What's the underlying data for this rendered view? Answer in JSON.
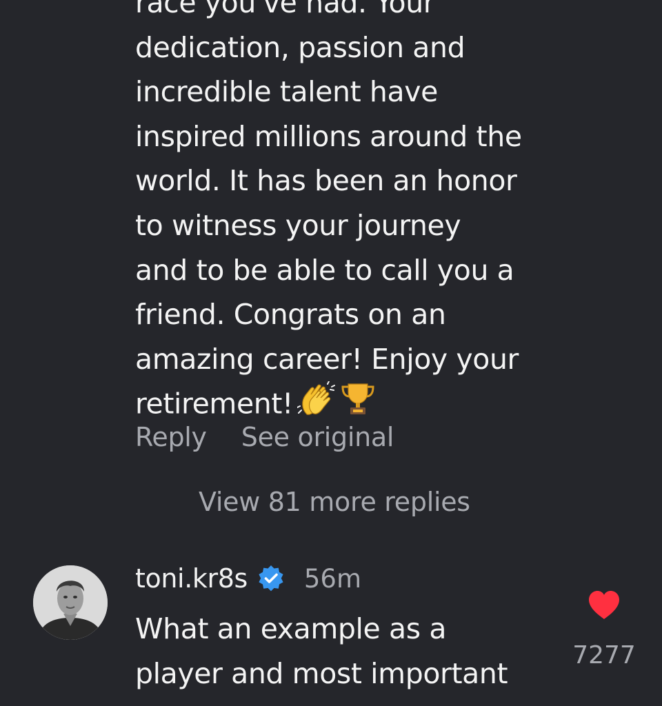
{
  "previous_comment": {
    "lines": [
      "race you've had. Your",
      "dedication, passion and",
      "incredible talent have",
      "inspired millions around the",
      "world. It has been an honor",
      "to witness your journey",
      "and to be able to call you a",
      "friend. Congrats on an",
      "amazing career! Enjoy your",
      "retirement!"
    ],
    "emojis": [
      "clapping-hands-emoji",
      "trophy-emoji"
    ],
    "reply_label": "Reply",
    "see_original_label": "See original"
  },
  "view_more_replies": "View 81 more replies",
  "comment": {
    "username": "toni.kr8s",
    "verified": true,
    "timestamp": "56m",
    "lines": [
      "What an example as a",
      "player and most important"
    ],
    "like_count": "7277",
    "liked": true
  },
  "colors": {
    "background": "#25262b",
    "text_primary": "#f4f4f4",
    "text_secondary": "#a8aab0",
    "verified_blue": "#3897f0",
    "heart_red": "#ff3040"
  }
}
